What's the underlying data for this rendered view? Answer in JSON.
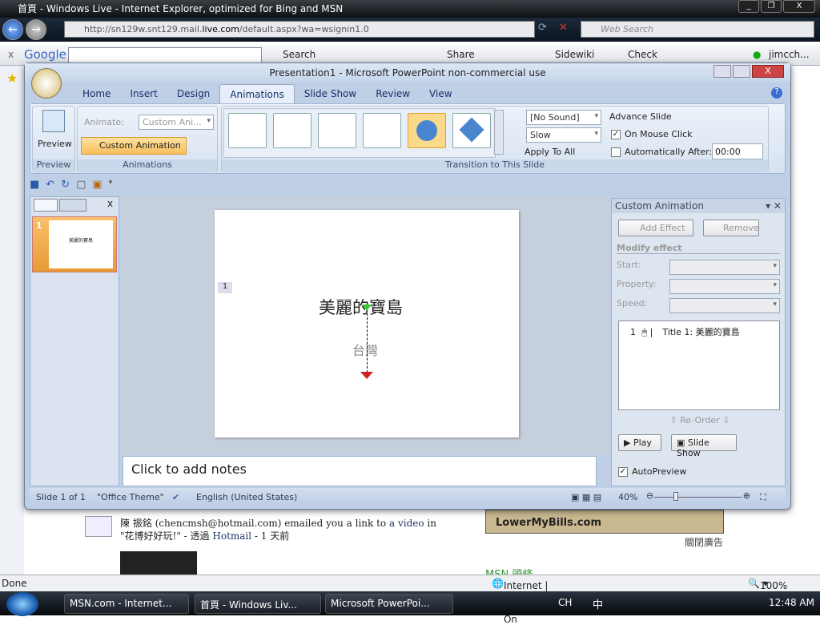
{
  "ie": {
    "title": "首頁 - Windows Live - Internet Explorer, optimized for Bing and MSN",
    "url_pre": "http://sn129w.snt129.mail.",
    "url_host": "live.com",
    "url_post": "/default.aspx?wa=wsignin1.0",
    "search_placeholder": "Web Search",
    "google": {
      "logo": "Google",
      "search": "Search",
      "share": "Share",
      "sidewiki": "Sidewiki",
      "check": "Check",
      "user": "jimcch..."
    },
    "status": {
      "done": "Done",
      "zone": "Internet | Protected Mode: On",
      "zoom": "100%"
    },
    "content": {
      "email_text": "陳 振銘 (chencmsh@hotmail.com) emailed you a link to ",
      "link_video": "a video",
      "email_text2": " in \"花博好好玩!\" - 透過 ",
      "link_hotmail": "Hotmail",
      "time": " - 1 天前",
      "ad": "LowerMyBills.com",
      "close_ad": "關閉廣告",
      "msn": "MSN 頭條"
    }
  },
  "ppt": {
    "title": "Presentation1 - Microsoft PowerPoint non-commercial use",
    "tabs": [
      "Home",
      "Insert",
      "Design",
      "Animations",
      "Slide Show",
      "Review",
      "View"
    ],
    "ribbon": {
      "preview": "Preview",
      "preview_group": "Preview",
      "animate_label": "Animate:",
      "animate_value": "Custom Ani...",
      "custom_animation": "Custom Animation",
      "animations_group": "Animations",
      "sound": "[No Sound]",
      "speed": "Slow",
      "apply_all": "Apply To All",
      "transition_group": "Transition to This Slide",
      "advance": "Advance Slide",
      "on_click": "On Mouse Click",
      "auto_after": "Automatically After:",
      "time": "00:00"
    },
    "slide": {
      "title": "美麗的寶島",
      "subtitle": "台灣",
      "marker": "1",
      "thumb_num": "1"
    },
    "notes": "Click to add notes",
    "pane": {
      "title": "Custom Animation",
      "add_effect": "Add Effect",
      "remove": "Remove",
      "modify": "Modify effect",
      "start": "Start:",
      "property": "Property:",
      "speed": "Speed:",
      "item_num": "1",
      "item": "Title 1: 美麗的寶島",
      "reorder": "Re-Order",
      "play": "Play",
      "slideshow": "Slide Show",
      "autopreview": "AutoPreview"
    },
    "status": {
      "slide": "Slide 1 of 1",
      "theme": "\"Office Theme\"",
      "lang": "English (United States)",
      "zoom": "40%"
    }
  },
  "taskbar": {
    "items": [
      "MSN.com - Internet...",
      "首頁 - Windows Liv...",
      "Microsoft PowerPoi..."
    ],
    "lang": "CH",
    "ime": "中",
    "time": "12:48 AM"
  }
}
